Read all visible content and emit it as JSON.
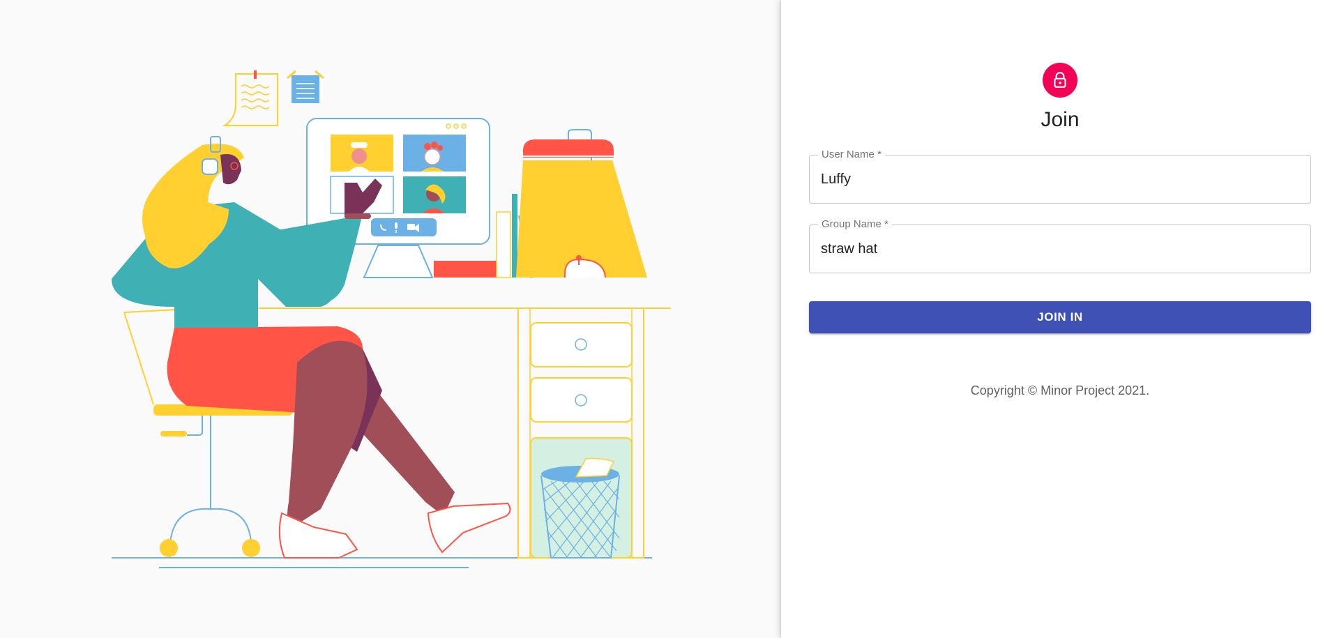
{
  "form": {
    "title": "Join",
    "lock_icon": "lock-icon",
    "user_name": {
      "label": "User Name *",
      "value": "Luffy"
    },
    "group_name": {
      "label": "Group Name *",
      "value": "straw hat"
    },
    "submit_label": "JOIN IN",
    "copyright": "Copyright © Minor Project 2021."
  },
  "colors": {
    "avatar": "#f50057",
    "primary_button": "#3f51b5",
    "hero_background": "#fafafa"
  }
}
